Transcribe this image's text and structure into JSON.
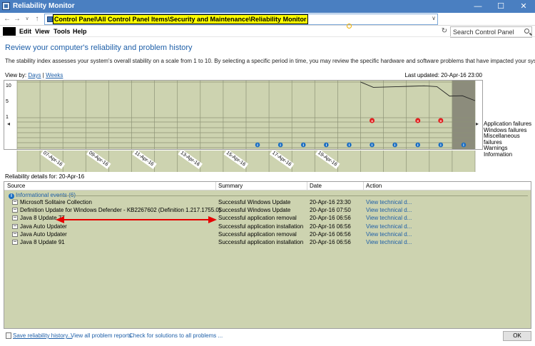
{
  "window": {
    "title": "Reliability Monitor",
    "min": "—",
    "max": "☐",
    "close": "✕"
  },
  "address": {
    "path": "Control Panel\\All Control Panel Items\\Security and Maintenance\\Reliability Monitor",
    "search_placeholder": "Search Control Panel"
  },
  "menu": [
    "Edit",
    "View",
    "Tools",
    "Help"
  ],
  "heading": "Review your computer's reliability and problem history",
  "description": "The stability index assesses your system's overall stability on a scale from 1 to 10. By selecting a specific period in time, you may review the specific hardware and software problems that have impacted your system.",
  "view_by": {
    "label": "View by:",
    "days": "Days",
    "weeks": "Weeks",
    "sep": "|"
  },
  "last_updated": "Last updated: 20-Apr-16 23:00",
  "chart_data": {
    "type": "line",
    "title": "",
    "x": [
      "07-Apr-16",
      "08-Apr-16",
      "09-Apr-16",
      "10-Apr-16",
      "11-Apr-16",
      "12-Apr-16",
      "13-Apr-16",
      "14-Apr-16",
      "15-Apr-16",
      "16-Apr-16",
      "17-Apr-16",
      "18-Apr-16",
      "19-Apr-16",
      "20-Apr-16"
    ],
    "tick_labels": [
      "07-Apr-16",
      "09-Apr-16",
      "11-Apr-16",
      "13-Apr-16",
      "15-Apr-16",
      "17-Apr-16",
      "19-Apr-16"
    ],
    "yticks": [
      "10",
      "5",
      "1"
    ],
    "ylim": [
      1,
      10
    ],
    "series": [
      {
        "values": [
          null,
          null,
          null,
          null,
          null,
          null,
          null,
          null,
          null,
          null,
          null,
          null,
          null,
          null,
          null,
          10,
          8.6,
          8.7,
          8.8,
          8.9,
          9.0,
          8.8,
          6.3,
          6.4,
          5.1
        ]
      }
    ],
    "categories": [
      "Application failures",
      "Windows failures",
      "Miscellaneous failures",
      "Warnings",
      "Information"
    ],
    "error_days": [
      "15-Apr-16",
      "17-Apr-16",
      "18-Apr-16"
    ],
    "info_days": [
      "11-Apr-16",
      "12-Apr-16",
      "13-Apr-16",
      "14-Apr-16",
      "15-Apr-16",
      "16-Apr-16",
      "17-Apr-16",
      "18-Apr-16",
      "19-Apr-16",
      "20-Apr-16"
    ],
    "selected": "20-Apr-16",
    "grid": true,
    "left_arrow": "◂",
    "right_arrow": "▸"
  },
  "details_for": "Reliability details for: 20-Apr-16",
  "columns": {
    "source": "Source",
    "summary": "Summary",
    "date": "Date",
    "action": "Action"
  },
  "group": {
    "label": "Informational events (6)",
    "icon": "i"
  },
  "rows": [
    {
      "source": "Microsoft Solitaire Collection",
      "summary": "Successful Windows Update",
      "date": "20-Apr-16 23:30",
      "action": "View  technical d..."
    },
    {
      "source": "Definition Update for Windows Defender - KB2267602 (Definition 1.217.1755.0)",
      "summary": "Successful Windows Update",
      "date": "20-Apr-16 07:50",
      "action": "View  technical d..."
    },
    {
      "source": "Java 8 Update 77",
      "summary": "Successful application removal",
      "date": "20-Apr-16 06:56",
      "action": "View  technical d..."
    },
    {
      "source": "Java Auto Updater",
      "summary": "Successful application installation",
      "date": "20-Apr-16 06:56",
      "action": "View  technical d..."
    },
    {
      "source": "Java Auto Updater",
      "summary": "Successful application removal",
      "date": "20-Apr-16 06:56",
      "action": "View  technical d..."
    },
    {
      "source": "Java 8 Update 91",
      "summary": "Successful application installation",
      "date": "20-Apr-16 06:56",
      "action": "View  technical d..."
    }
  ],
  "footer": {
    "save": "Save reliability history...",
    "view_all": "View all problem reports",
    "check": "Check for solutions to all problems ...",
    "ok": "OK"
  },
  "colors": {
    "plot_bg": "#cdd3b0",
    "grid": "#8e9377",
    "selected_col": "#8c8c7c",
    "info": "#1b6ec2",
    "error": "#e11d1d",
    "arrow": "#e60000",
    "link": "#1e5fa8"
  }
}
